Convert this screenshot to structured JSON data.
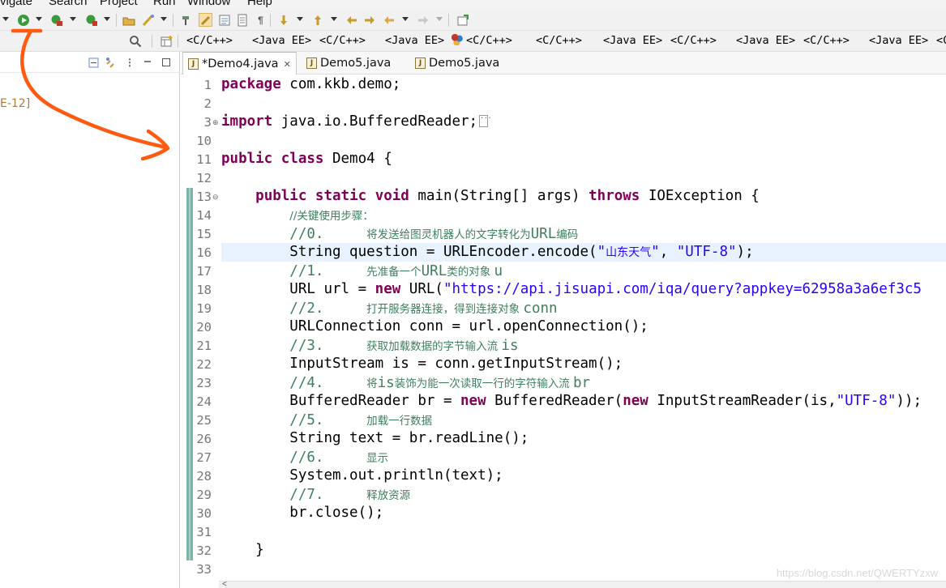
{
  "menu": {
    "navigate": "vigate",
    "search": "Search",
    "project": "Project",
    "run": "Run",
    "window": "Window",
    "help": "Help"
  },
  "toolbar": {
    "icons": [
      "debug-icon",
      "run-icon",
      "coverage-icon",
      "external-tools-icon",
      "open-type-icon",
      "open-task-icon",
      "search-icon",
      "toggle-mark-occurrences-icon",
      "toggle-block-selection-icon",
      "show-whitespace-icon",
      "next-annotation-icon",
      "previous-annotation-icon",
      "last-edit-location-icon",
      "back-icon",
      "forward-icon",
      "pin-editor-icon"
    ]
  },
  "perspectives": [
    {
      "label": "<C/C++>",
      "icon": ""
    },
    {
      "label": "<Java EE>",
      "icon": ""
    },
    {
      "label": "<C/C++>",
      "icon": ""
    },
    {
      "label": "<Java EE>",
      "icon": ""
    },
    {
      "label": "<C/C++>",
      "icon": "team-icon"
    },
    {
      "label": "<C/C++>",
      "icon": ""
    },
    {
      "label": "<Java EE>",
      "icon": ""
    },
    {
      "label": "<C/C++>",
      "icon": ""
    },
    {
      "label": "<Java EE>",
      "icon": ""
    },
    {
      "label": "<C/C++>",
      "icon": ""
    },
    {
      "label": "<Java EE>",
      "icon": ""
    },
    {
      "label": "<C",
      "icon": ""
    }
  ],
  "left_panel": {
    "item": "E-12]"
  },
  "editor_tabs": [
    {
      "label": "*Demo4.java",
      "active": true,
      "close": "✕"
    },
    {
      "label": "Demo5.java",
      "active": false
    },
    {
      "label": "Demo5.java",
      "active": false
    }
  ],
  "code": {
    "line_numbers": [
      "1",
      "2",
      "3",
      "10",
      "11",
      "12",
      "13",
      "14",
      "15",
      "16",
      "17",
      "18",
      "19",
      "20",
      "21",
      "22",
      "23",
      "24",
      "25",
      "26",
      "27",
      "28",
      "29",
      "30",
      "31",
      "32",
      "33"
    ],
    "l1_kw": "package",
    "l1_rest": " com.kkb.demo;",
    "l3_kw": "import",
    "l3_rest": " java.io.BufferedReader;",
    "l11_kw1": "public",
    "l11_kw2": "class",
    "l11_rest": " Demo4 {",
    "l13_kw1": "public",
    "l13_kw2": "static",
    "l13_kw3": "void",
    "l13_rest": " main(String[] args) ",
    "l13_kw4": "throws",
    "l13_rest2": " IOException {",
    "l14_cm": "//关键使用步骤：",
    "l15_cm_a": "//0.     ",
    "l15_cm_b": "将发送给图灵机器人的文字转化为",
    "l15_cm_c": "URL",
    "l15_cm_d": "编码",
    "l16_a": "String question = URLEncoder.encode(",
    "l16_str1a": "\"",
    "l16_str1b": "山东天气",
    "l16_str1c": "\"",
    "l16_b": ", ",
    "l16_str2": "\"UTF-8\"",
    "l16_c": ");",
    "l17_cm_a": "//1.     ",
    "l17_cm_b": "先准备一个",
    "l17_cm_c": "URL",
    "l17_cm_d": "类的对象 ",
    "l17_cm_e": "u",
    "l18_a": "URL url = ",
    "l18_kw": "new",
    "l18_b": " URL(",
    "l18_str": "\"https://api.jisuapi.com/iqa/query?appkey=62958a3a6ef3c5",
    "l19_cm_a": "//2.     ",
    "l19_cm_b": "打开服务器连接，得到连接对象 ",
    "l19_cm_c": "conn",
    "l20": "URLConnection conn = url.openConnection();",
    "l21_cm_a": "//3.     ",
    "l21_cm_b": "获取加载数据的字节输入流 ",
    "l21_cm_c": "is",
    "l22": "InputStream is = conn.getInputStream();",
    "l23_cm_a": "//4.     ",
    "l23_cm_b": "将",
    "l23_cm_c": "is",
    "l23_cm_d": "装饰为能一次读取一行的字符输入流 ",
    "l23_cm_e": "br",
    "l24_a": "BufferedReader br = ",
    "l24_kw1": "new",
    "l24_b": " BufferedReader(",
    "l24_kw2": "new",
    "l24_c": " InputStreamReader(is,",
    "l24_str": "\"UTF-8\"",
    "l24_d": "));",
    "l25_cm_a": "//5.     ",
    "l25_cm_b": "加载一行数据",
    "l26": "String text = br.readLine();",
    "l27_cm_a": "//6.     ",
    "l27_cm_b": "显示",
    "l28": "System.out.println(text);",
    "l29_cm_a": "//7.     ",
    "l29_cm_b": "释放资源",
    "l30": "br.close();",
    "l32": "}"
  },
  "watermark": "https://blog.csdn.net/QWERTYzxw",
  "colors": {
    "keyword": "#7f0055",
    "string": "#2a00ff",
    "comment": "#3f7f5f",
    "annotation_arrow": "#ff5a12",
    "current_line": "#e8f2fe"
  }
}
